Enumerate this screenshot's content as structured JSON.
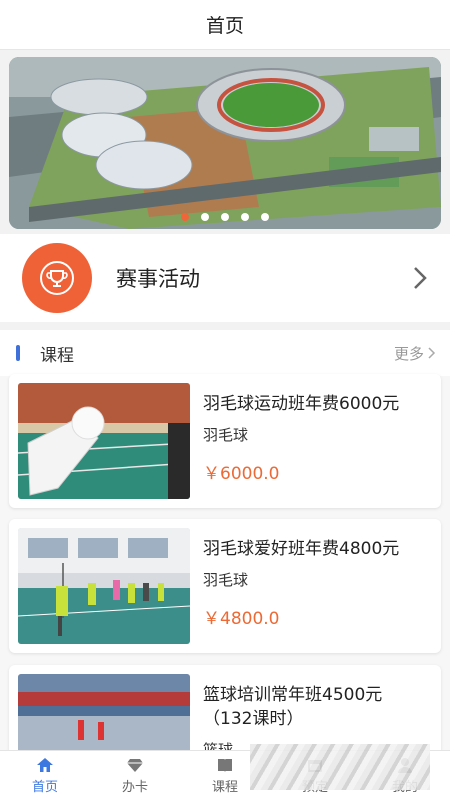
{
  "header": {
    "title": "首页"
  },
  "banner": {
    "slide_count": 5,
    "active_index": 0,
    "dot_active_color": "#f0663a"
  },
  "events": {
    "label": "赛事活动",
    "icon": "trophy-icon",
    "circle_color": "#ef6238"
  },
  "courses": {
    "section_title": "课程",
    "more_label": "更多",
    "items": [
      {
        "name": "羽毛球运动班年费6000元",
        "category": "羽毛球",
        "price": "￥6000.0",
        "image": "badminton-shuttlecock-photo"
      },
      {
        "name": "羽毛球爱好班年费4800元",
        "category": "羽毛球",
        "price": "￥4800.0",
        "image": "badminton-class-photo"
      },
      {
        "name": "篮球培训常年班4500元（132课时）",
        "category": "篮球",
        "price": "",
        "image": "sports-hall-photo"
      }
    ]
  },
  "tabbar": {
    "items": [
      {
        "label": "首页",
        "icon": "home-icon",
        "active": true
      },
      {
        "label": "办卡",
        "icon": "diamond-icon",
        "active": false
      },
      {
        "label": "课程",
        "icon": "book-icon",
        "active": false
      },
      {
        "label": "预定",
        "icon": "calendar-icon",
        "active": false
      },
      {
        "label": "我的",
        "icon": "user-icon",
        "active": false
      }
    ]
  },
  "colors": {
    "accent": "#3d78e0",
    "price": "#ec6a35",
    "section_bar": "#3f6fd8"
  }
}
